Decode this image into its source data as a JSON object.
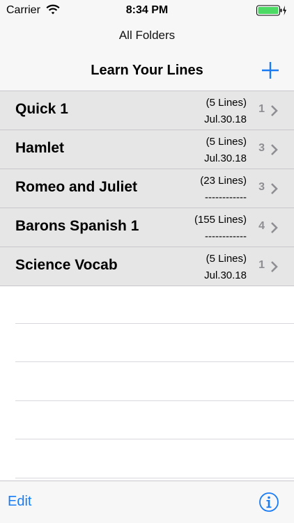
{
  "status_bar": {
    "carrier": "Carrier",
    "time": "8:34 PM"
  },
  "nav": {
    "back_title": "All Folders",
    "title": "Learn Your Lines",
    "add_icon": "plus-icon"
  },
  "rows": [
    {
      "title": "Quick 1",
      "lines": "(5 Lines)",
      "date": "Jul.30.18",
      "count": "1"
    },
    {
      "title": "Hamlet",
      "lines": "(5 Lines)",
      "date": "Jul.30.18",
      "count": "3"
    },
    {
      "title": "Romeo and Juliet",
      "lines": "(23 Lines)",
      "date": "------------",
      "count": "3"
    },
    {
      "title": "Barons Spanish 1",
      "lines": "(155 Lines)",
      "date": "------------",
      "count": "4"
    },
    {
      "title": "Science Vocab",
      "lines": "(5 Lines)",
      "date": "Jul.30.18",
      "count": "1"
    }
  ],
  "toolbar": {
    "edit_label": "Edit",
    "info_icon": "info-icon"
  },
  "colors": {
    "accent": "#1a7cf5",
    "battery": "#4cd964",
    "row_bg": "#e6e6e6"
  }
}
